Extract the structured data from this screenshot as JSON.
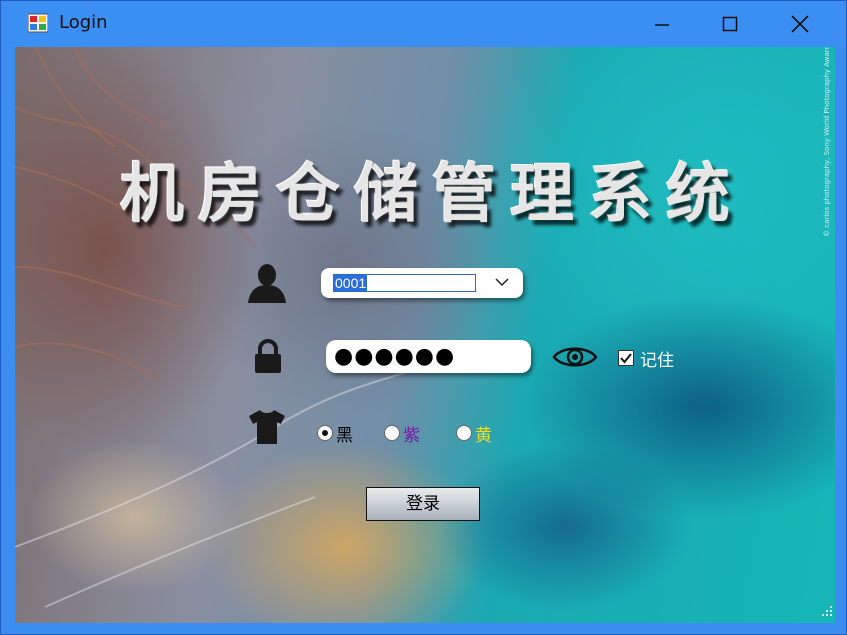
{
  "window": {
    "title": "Login",
    "controls": {
      "minimize": "minimize-icon",
      "maximize": "maximize-icon",
      "close": "close-icon"
    }
  },
  "app": {
    "title": "机房仓储管理系统",
    "photo_credit": "© carlos photography, Sony World Photography Awards"
  },
  "form": {
    "user_combo": {
      "value": "0001"
    },
    "password": {
      "masked_value": "●●●●●●"
    },
    "remember": {
      "label": "记住",
      "checked": true
    },
    "theme_options": [
      {
        "label": "黑",
        "checked": true,
        "color": "#000000"
      },
      {
        "label": "紫",
        "checked": false,
        "color": "#7a1aa8"
      },
      {
        "label": "黄",
        "checked": false,
        "color": "#f0e020"
      }
    ],
    "login_button": "登录"
  },
  "colors": {
    "titlebar": "#3c8ff2",
    "selection": "#2a6fd9"
  }
}
